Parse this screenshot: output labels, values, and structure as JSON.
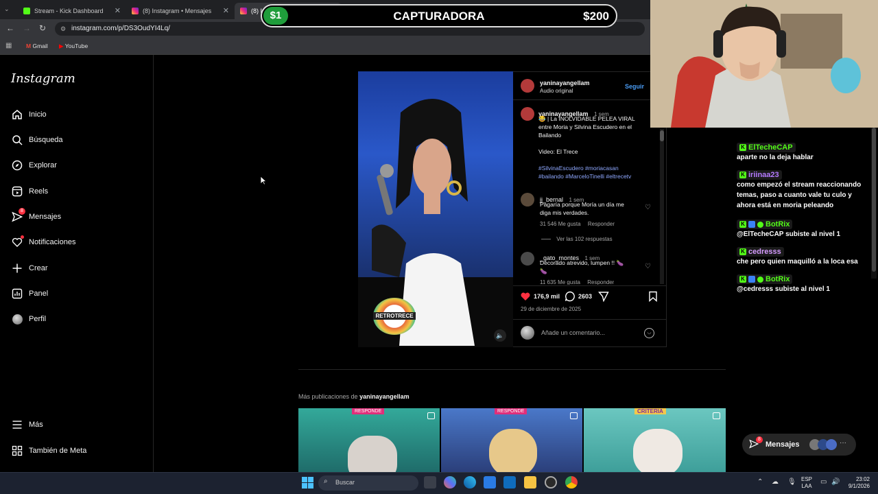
{
  "browser": {
    "tabs": [
      {
        "label": "Stream - Kick Dashboard"
      },
      {
        "label": "(8) Instagram • Mensajes"
      },
      {
        "label": "(8) In"
      }
    ],
    "url": "instagram.com/p/DS3OudYI4Lq/",
    "bookmarks": [
      {
        "label": "Gmail"
      },
      {
        "label": "YouTube"
      }
    ]
  },
  "overlay": {
    "left_price": "$1",
    "title": "CAPTURADORA",
    "right_price": "$200"
  },
  "sidebar": {
    "logo": "Instagram",
    "items": [
      {
        "label": "Inicio",
        "icon": "home-icon"
      },
      {
        "label": "Búsqueda",
        "icon": "search-icon"
      },
      {
        "label": "Explorar",
        "icon": "compass-icon"
      },
      {
        "label": "Reels",
        "icon": "reels-icon"
      },
      {
        "label": "Mensajes",
        "icon": "messenger-icon",
        "badge": "8"
      },
      {
        "label": "Notificaciones",
        "icon": "heart-icon"
      },
      {
        "label": "Crear",
        "icon": "plus-icon"
      },
      {
        "label": "Panel",
        "icon": "chart-icon"
      },
      {
        "label": "Perfil",
        "icon": "avatar-icon"
      }
    ],
    "more": "Más",
    "meta": "También de Meta"
  },
  "post": {
    "author": "yaninayangellam",
    "audio": "Audio original",
    "follow": "Seguir",
    "caption_time": "1 sem",
    "caption_lines": [
      "😂 | La INOLVIDABLE PELEA VIRAL",
      "entre Moria y Silvina Escudero en el",
      "Bailando"
    ],
    "caption_credit": "Video: El Trece",
    "hashtags_1": "#SilvinaEscudero #moriacasan",
    "hashtags_2": "#bailando #MarceloTinelli #eltrecetv",
    "video_logo": "RETROTRECE",
    "comments": [
      {
        "user": "jj_bernal",
        "time": "1 sem",
        "lines": [
          "Pagaría porque Moría un día me",
          "diga mis verdades."
        ],
        "likes": "31 546 Me gusta",
        "reply": "Responder",
        "view_replies": "Ver las 102 respuestas"
      },
      {
        "user": "_gato_montes",
        "time": "1 sem",
        "lines": [
          "Decorado atrevido, lumpen !! 🍆",
          "🍆"
        ],
        "likes": "11 635 Me gusta",
        "reply": "Responder"
      }
    ],
    "likes": "176,9 mil",
    "comments_count": "2603",
    "date": "29 de diciembre de 2025",
    "comment_placeholder": "Añade un comentario..."
  },
  "more_posts": {
    "prefix": "Más publicaciones de ",
    "user": "yaninayangellam",
    "thumb_labels": [
      "RESPONDE",
      "RESPONDE",
      "CRITERIA"
    ]
  },
  "chat": {
    "messages": [
      {
        "user": "ElTecheCAP",
        "text": "aparte no la deja hablar",
        "color": "#53fc18"
      },
      {
        "user": "iriinaa23",
        "text": "como empezó el stream reaccionando temas, paso a cuanto vale tu culo y ahora está en moria peleando",
        "color": "#b57bff"
      },
      {
        "user": "BotRix",
        "text": "@ElTecheCAP subiste al nivel 1",
        "color": "#53fc18"
      },
      {
        "user": "cedresss",
        "text": "che pero quien maquilló a la loca esa",
        "color": "#d59bff"
      },
      {
        "user": "BotRix",
        "text": "@cedresss subiste al nivel 1",
        "color": "#53fc18"
      }
    ],
    "dm_badge": "8",
    "dm_label": "Mensajes"
  },
  "taskbar": {
    "search_placeholder": "Buscar",
    "lang_1": "ESP",
    "lang_2": "LAA",
    "time": "23:02",
    "date": "9/1/2026"
  }
}
